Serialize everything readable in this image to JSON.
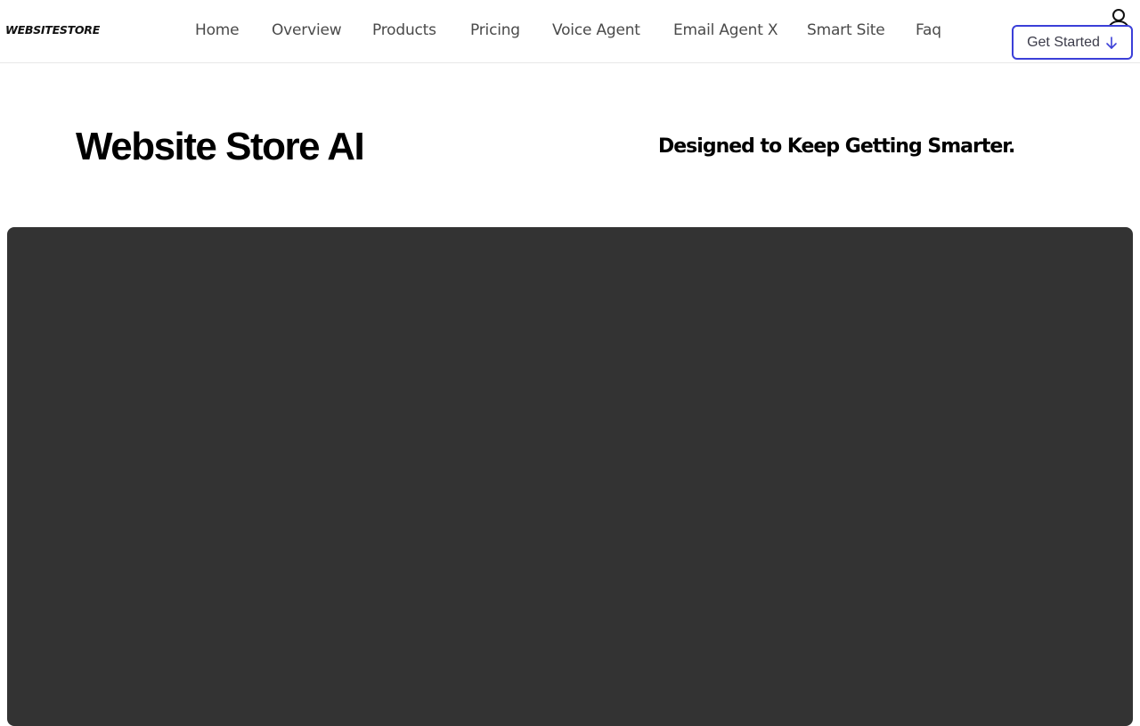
{
  "header": {
    "logo_text": "WEBSITESTORE",
    "nav": [
      {
        "label": "Home"
      },
      {
        "label": "Overview"
      },
      {
        "label": "Products"
      },
      {
        "label": "Pricing"
      },
      {
        "label": "Voice Agent"
      },
      {
        "label": "Email Agent X"
      },
      {
        "label": "Smart Site"
      },
      {
        "label": "Faq"
      }
    ],
    "user_icon": "user-icon",
    "cta_label": "Get Started",
    "cta_icon": "arrow-down-icon"
  },
  "hero": {
    "title": "Website Store AI",
    "tagline": "Designed to Keep Getting Smarter."
  },
  "colors": {
    "accent": "#3b3fd8",
    "panel": "#333333",
    "nav_text": "#4a4a4a"
  }
}
